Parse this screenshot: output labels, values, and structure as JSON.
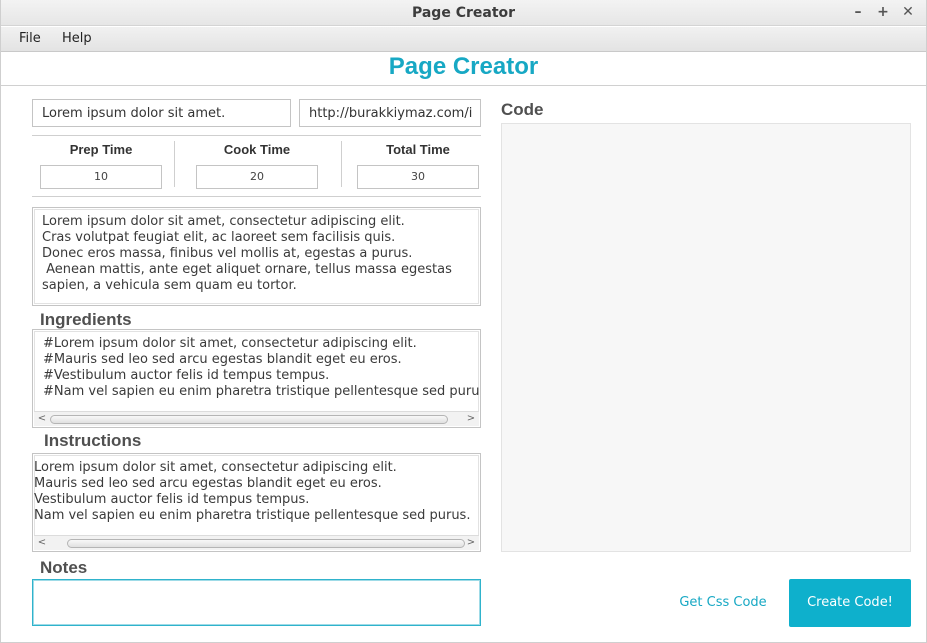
{
  "window": {
    "title": "Page Creator",
    "minimize_glyph": "–",
    "maximize_glyph": "+",
    "close_glyph": "✕"
  },
  "menu": [
    "File",
    "Help"
  ],
  "app_title": "Page Creator",
  "title_field": {
    "value": "Lorem ipsum dolor sit amet."
  },
  "url_field": {
    "value": "http://burakkiymaz.com/i"
  },
  "times": [
    {
      "label": "Prep Time",
      "value": "10"
    },
    {
      "label": "Cook Time",
      "value": "20"
    },
    {
      "label": "Total Time",
      "value": "30"
    }
  ],
  "description": {
    "lines": [
      "Lorem ipsum dolor sit amet, consectetur adipiscing elit.",
      "Cras volutpat feugiat elit, ac laoreet sem facilisis quis.",
      "Donec eros massa, finibus vel mollis at, egestas a purus.",
      " Aenean mattis, ante eget aliquet ornare, tellus massa egestas",
      "sapien, a vehicula sem quam eu tortor."
    ]
  },
  "ingredients": {
    "label": "Ingredients",
    "lines": [
      "#Lorem ipsum dolor sit amet, consectetur adipiscing elit.",
      "#Mauris sed leo sed arcu egestas blandit eget eu eros.",
      "#Vestibulum auctor felis id tempus tempus.",
      "#Nam vel sapien eu enim pharetra tristique pellentesque sed puru"
    ]
  },
  "instructions": {
    "label": "Instructions",
    "lines": [
      "Lorem ipsum dolor sit amet, consectetur adipiscing elit.",
      "Mauris sed leo sed arcu egestas blandit eget eu eros.",
      "Vestibulum auctor felis id tempus tempus.",
      "Nam vel sapien eu enim pharetra tristique pellentesque sed purus."
    ]
  },
  "scroll_arrows": {
    "left": "<",
    "right": ">"
  },
  "notes": {
    "label": "Notes",
    "value": ""
  },
  "code": {
    "label": "Code",
    "value": ""
  },
  "buttons": {
    "css_code": "Get Css Code",
    "create_code": "Create Code!"
  },
  "colors": {
    "accent": "#17a8c4",
    "primary_button": "#0eb0cc"
  }
}
